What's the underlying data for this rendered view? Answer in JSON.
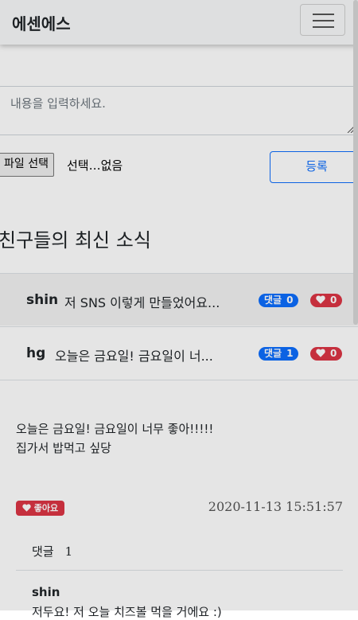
{
  "navbar": {
    "brand": "에센에스"
  },
  "composer": {
    "placeholder": "내용을 입력하세요.",
    "file_button": "파일 선택",
    "file_status": "선택…없음",
    "submit": "등록"
  },
  "section_title": "친구들의 최신 소식",
  "feed": [
    {
      "user": "shin",
      "preview": "저 SNS 이렇게 만들었어요...",
      "comment_label": "댓글",
      "comment_count": "0",
      "like_count": "0"
    },
    {
      "user": "hg",
      "preview": "오늘은 금요일! 금요일이 너...",
      "comment_label": "댓글",
      "comment_count": "1",
      "like_count": "0"
    }
  ],
  "detail": {
    "lines": [
      "오늘은 금요일! 금요일이 너무 좋아!!!!!",
      "집가서 밥먹고 싶당"
    ],
    "like_label": "좋아요",
    "timestamp": "2020-11-13 15:51:57",
    "comments_label": "댓글",
    "comments_count": "1",
    "comment": {
      "user": "shin",
      "text": "저두요! 저 오늘 치즈볼 먹을 거에요 :)"
    }
  },
  "colors": {
    "primary": "#0d6efd",
    "danger": "#dc3545"
  }
}
